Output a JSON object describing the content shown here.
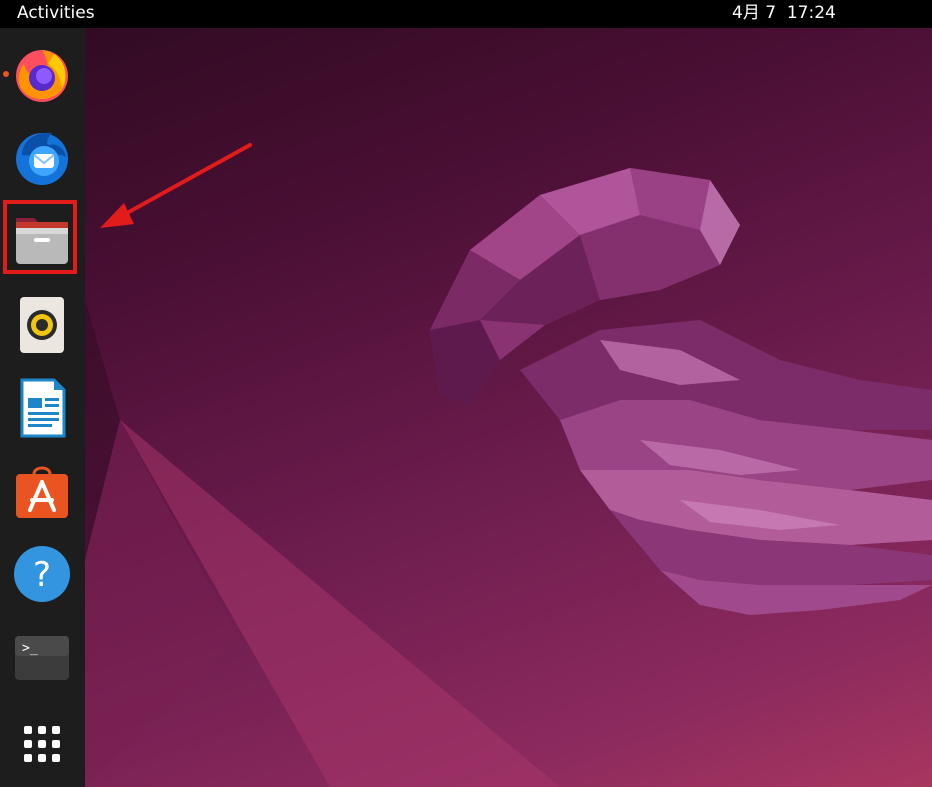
{
  "topbar": {
    "activities_label": "Activities",
    "clock_text": "4月 7  17:24"
  },
  "dock": {
    "items": [
      {
        "name": "firefox",
        "icon": "firefox-icon",
        "running": true
      },
      {
        "name": "thunderbird",
        "icon": "thunderbird-icon"
      },
      {
        "name": "files",
        "icon": "files-folder-icon",
        "highlighted": true
      },
      {
        "name": "rhythmbox",
        "icon": "speaker-icon"
      },
      {
        "name": "libreoffice-writer",
        "icon": "writer-document-icon"
      },
      {
        "name": "app-center",
        "icon": "shopping-bag-icon"
      },
      {
        "name": "help",
        "icon": "help-icon"
      },
      {
        "name": "terminal",
        "icon": "terminal-icon"
      },
      {
        "name": "show-applications",
        "icon": "app-grid-icon"
      }
    ]
  },
  "help_glyph": "?",
  "terminal_prompt": ">_",
  "colors": {
    "accent": "#e95420",
    "annotation": "#e21b1b",
    "dock_bg": "#1d1d1d"
  }
}
